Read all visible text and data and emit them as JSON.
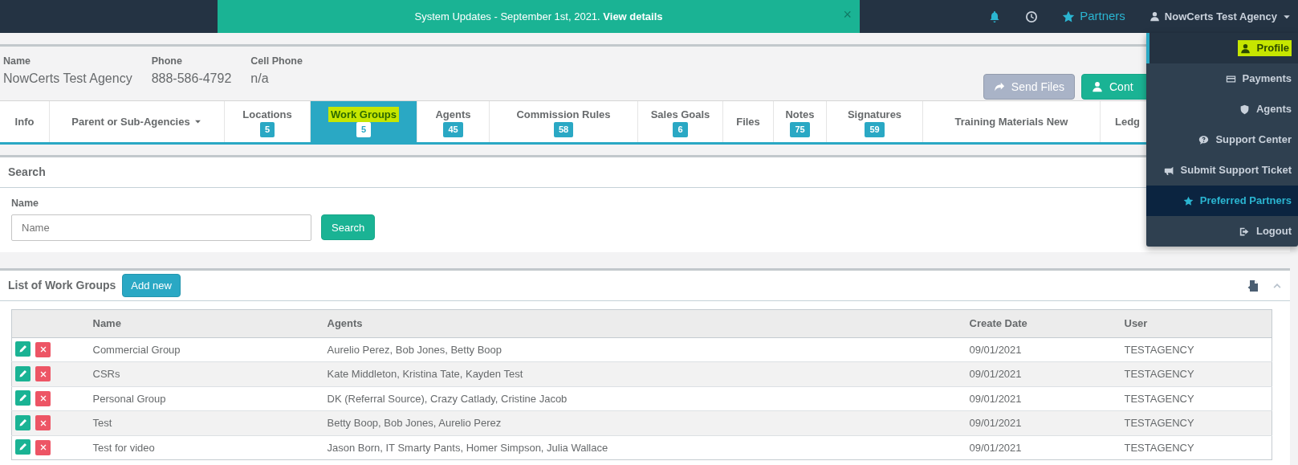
{
  "topbar": {
    "announcement": {
      "text": "System Updates - September 1st, 2021.",
      "link": "View details",
      "close": "×"
    },
    "partners_link": "Partners",
    "user_menu": "NowCerts Test Agency"
  },
  "user_dropdown": {
    "items": [
      {
        "label": "Profile",
        "selected": true,
        "hovered": false,
        "marked": true
      },
      {
        "label": "Payments",
        "selected": false,
        "hovered": false,
        "marked": false
      },
      {
        "label": "Agents",
        "selected": false,
        "hovered": false,
        "marked": false
      },
      {
        "label": "Support Center",
        "selected": false,
        "hovered": false,
        "marked": false
      },
      {
        "label": "Submit Support Ticket",
        "selected": false,
        "hovered": false,
        "marked": false
      },
      {
        "label": "Preferred Partners",
        "selected": false,
        "hovered": true,
        "marked": false
      },
      {
        "label": "Logout",
        "selected": false,
        "hovered": false,
        "marked": false
      }
    ]
  },
  "agency": {
    "fields": [
      {
        "label": "Name",
        "value": "NowCerts Test Agency"
      },
      {
        "label": "Phone",
        "value": "888-586-4792"
      },
      {
        "label": "Cell Phone",
        "value": "n/a"
      }
    ],
    "buttons": [
      {
        "label": "Send Files",
        "kind": "send"
      },
      {
        "label": "Cont",
        "kind": "contact"
      }
    ]
  },
  "tabs": [
    {
      "label": "Info",
      "selected": false,
      "marked": false,
      "has_menu": false
    },
    {
      "label": "Parent or Sub-Agencies",
      "selected": false,
      "marked": false,
      "has_menu": true
    },
    {
      "label": "Locations",
      "count": "5",
      "selected": false,
      "marked": false,
      "has_menu": false
    },
    {
      "label": "Work Groups",
      "count": "5",
      "selected": true,
      "marked": true,
      "has_menu": false
    },
    {
      "label": "Agents",
      "count": "45",
      "selected": false,
      "marked": false,
      "has_menu": false
    },
    {
      "label": "Commission Rules",
      "count": "58",
      "selected": false,
      "marked": false,
      "has_menu": false
    },
    {
      "label": "Sales Goals",
      "count": "6",
      "selected": false,
      "marked": false,
      "has_menu": false
    },
    {
      "label": "Files",
      "selected": false,
      "marked": false,
      "has_menu": false
    },
    {
      "label": "Notes",
      "count": "75",
      "selected": false,
      "marked": false,
      "has_menu": false
    },
    {
      "label": "Signatures",
      "count": "59",
      "selected": false,
      "marked": false,
      "has_menu": false
    },
    {
      "label": "Training Materials New",
      "selected": false,
      "marked": false,
      "has_menu": false
    },
    {
      "label": "Ledg",
      "selected": false,
      "marked": false,
      "has_menu": false
    }
  ],
  "search": {
    "title": "Search",
    "field_label": "Name",
    "placeholder": "Name",
    "button": "Search"
  },
  "list": {
    "title": "List of Work Groups",
    "add_button": "Add new",
    "columns": [
      "Name",
      "Agents",
      "Create Date",
      "User"
    ],
    "rows": [
      {
        "name": "Commercial Group",
        "agents": "Aurelio Perez, Bob Jones, Betty Boop",
        "create_date": "09/01/2021",
        "user": "TESTAGENCY"
      },
      {
        "name": "CSRs",
        "agents": "Kate Middleton, Kristina Tate, Kayden Test",
        "create_date": "09/01/2021",
        "user": "TESTAGENCY"
      },
      {
        "name": "Personal Group",
        "agents": "DK (Referral Source), Crazy Catlady, Cristine Jacob",
        "create_date": "09/01/2021",
        "user": "TESTAGENCY"
      },
      {
        "name": "Test",
        "agents": "Betty Boop, Bob Jones, Aurelio Perez",
        "create_date": "09/01/2021",
        "user": "TESTAGENCY"
      },
      {
        "name": "Test for video",
        "agents": "Jason Born, IT Smarty Pants, Homer Simpson, Julia Wallace",
        "create_date": "09/01/2021",
        "user": "TESTAGENCY"
      }
    ]
  }
}
